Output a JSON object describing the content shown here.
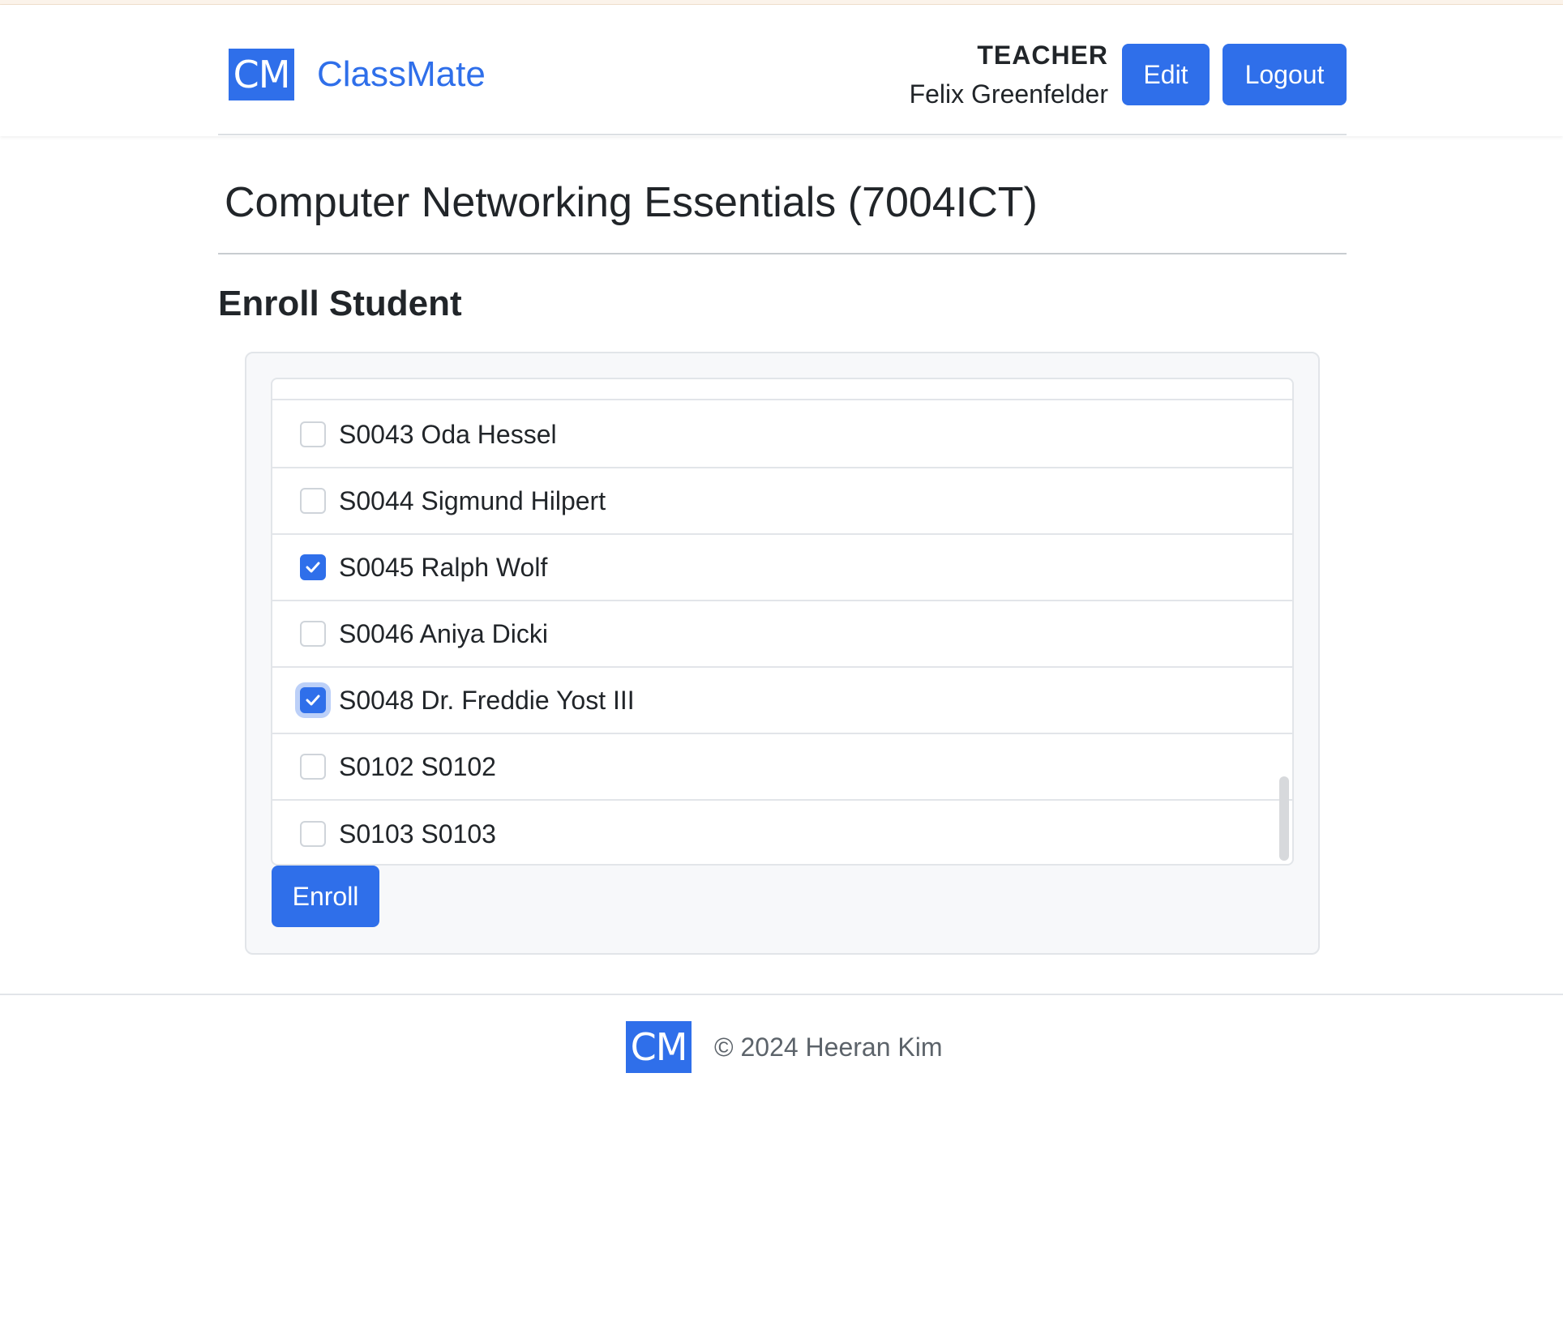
{
  "header": {
    "logo_text": "CM",
    "brand": "ClassMate",
    "role": "TEACHER",
    "username": "Felix Greenfelder",
    "edit_label": "Edit",
    "logout_label": "Logout"
  },
  "main": {
    "course_title": "Computer Networking Essentials (7004ICT)",
    "section_title": "Enroll Student",
    "students": [
      {
        "label": "S0043 Oda Hessel",
        "checked": false
      },
      {
        "label": "S0044 Sigmund Hilpert",
        "checked": false
      },
      {
        "label": "S0045 Ralph Wolf",
        "checked": true
      },
      {
        "label": "S0046 Aniya Dicki",
        "checked": false
      },
      {
        "label": "S0048 Dr. Freddie Yost III",
        "checked": true,
        "focused": true
      },
      {
        "label": "S0102 S0102",
        "checked": false
      },
      {
        "label": "S0103 S0103",
        "checked": false
      }
    ],
    "enroll_label": "Enroll"
  },
  "footer": {
    "logo_text": "CM",
    "copyright": "© 2024 Heeran Kim"
  },
  "colors": {
    "accent": "#2f6fea",
    "text": "#212529",
    "muted": "#5c636a"
  }
}
